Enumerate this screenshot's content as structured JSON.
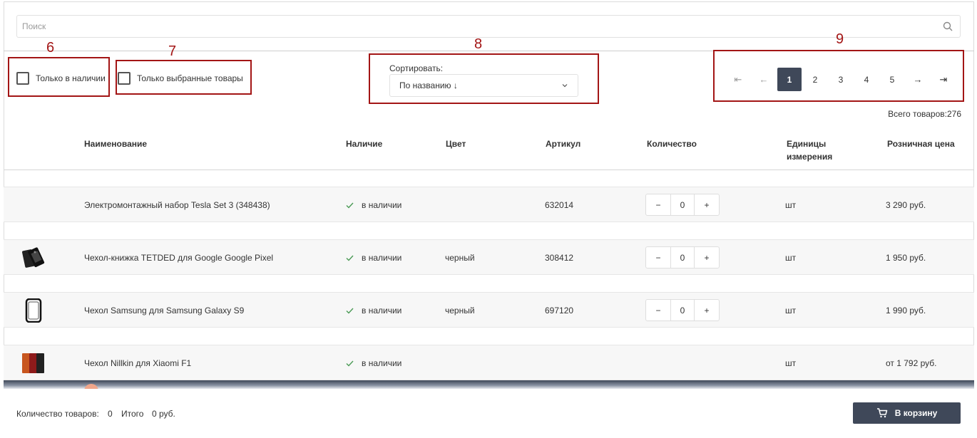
{
  "search": {
    "placeholder": "Поиск",
    "value": ""
  },
  "annotations": [
    "6",
    "7",
    "8",
    "9"
  ],
  "filters": {
    "in_stock_label": "Только в наличии",
    "selected_only_label": "Только выбранные товары"
  },
  "sort": {
    "label": "Сортировать:",
    "value": "По названию ↓"
  },
  "pagination": {
    "first": "⇤",
    "prev": "←",
    "pages": [
      "1",
      "2",
      "3",
      "4",
      "5"
    ],
    "active": "1",
    "next": "→",
    "last": "⇥"
  },
  "total": "Всего товаров:276",
  "table": {
    "headers": {
      "name": "Наименование",
      "availability": "Наличие",
      "color": "Цвет",
      "sku": "Артикул",
      "quantity": "Количество",
      "unit_line1": "Единицы",
      "unit_line2": "измерения",
      "price": "Розничная цена"
    },
    "rows": [
      {
        "name": "Электромонтажный набор Tesla Set 3 (348438)",
        "availability": "в наличии",
        "color": "",
        "sku": "632014",
        "qty": "0",
        "unit": "шт",
        "price": "3 290 руб.",
        "thumb": "none"
      },
      {
        "name": "Чехол-книжка TETDED для Google Google Pixel",
        "availability": "в наличии",
        "color": "черный",
        "sku": "308412",
        "qty": "0",
        "unit": "шт",
        "price": "1 950 руб.",
        "thumb": "wallet-case"
      },
      {
        "name": "Чехол Samsung для Samsung Galaxy S9",
        "availability": "в наличии",
        "color": "черный",
        "sku": "697120",
        "qty": "0",
        "unit": "шт",
        "price": "1 990 руб.",
        "thumb": "clear-case"
      },
      {
        "name": "Чехол Nillkin для Xiaomi F1",
        "availability": "в наличии",
        "color": "",
        "sku": "",
        "qty": "",
        "unit": "шт",
        "price": "от 1 792 руб.",
        "thumb": "color-cases"
      }
    ],
    "minus": "−",
    "plus": "+"
  },
  "footer": {
    "count_label": "Количество товаров:",
    "count_value": "0",
    "total_label": "Итого",
    "total_value": "0 руб.",
    "cart_button": "В корзину"
  },
  "colors": {
    "accent": "#3f4859",
    "annotation": "#a31515",
    "row_bg": "#f7f7f7",
    "tick": "#4a9a55"
  }
}
